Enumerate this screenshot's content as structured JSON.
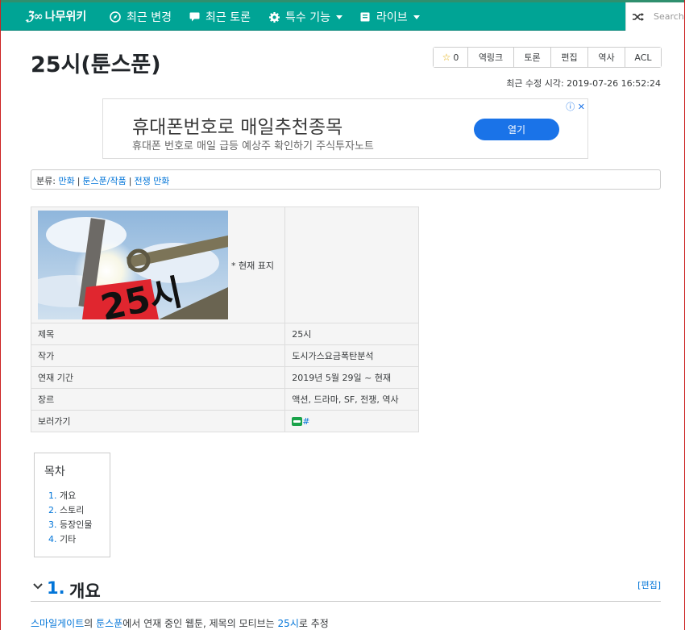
{
  "nav": {
    "brand": "나무위키",
    "items": [
      {
        "label": "최근 변경"
      },
      {
        "label": "최근 토론"
      },
      {
        "label": "특수 기능"
      },
      {
        "label": "라이브"
      }
    ],
    "search_placeholder": "Search"
  },
  "page": {
    "title": "25시(툰스푼)",
    "star_count": "0",
    "tools": [
      "역링크",
      "토론",
      "편집",
      "역사",
      "ACL"
    ],
    "last_modified": "최근 수정 시각: 2019-07-26 16:52:24"
  },
  "ad": {
    "headline": "휴대폰번호로 매일추천종목",
    "subline": "휴대폰 번호로 매일 급등 예상주 확인하기 주식투자노트",
    "button": "열기"
  },
  "category": {
    "label": "분류:",
    "links": [
      "만화",
      "툰스푼/작품",
      "전쟁 만화"
    ]
  },
  "infobox": {
    "image_caption": "* 현재 표지",
    "poster_text": "25시",
    "rows": [
      {
        "key": "제목",
        "value": "25시"
      },
      {
        "key": "작가",
        "value": "도시가스요금폭탄분석"
      },
      {
        "key": "연재 기간",
        "value": "2019년 5월 29일 ~ 현재"
      },
      {
        "key": "장르",
        "value": "액션, 드라마, SF, 전쟁, 역사"
      },
      {
        "key": "보러가기",
        "value": "#"
      }
    ]
  },
  "toc": {
    "title": "목차",
    "items": [
      {
        "num": "1.",
        "label": "개요"
      },
      {
        "num": "2.",
        "label": "스토리"
      },
      {
        "num": "3.",
        "label": "등장인물"
      },
      {
        "num": "4.",
        "label": "기타"
      }
    ]
  },
  "section": {
    "num": "1.",
    "title": "개요",
    "edit": "[편집]",
    "para": {
      "link1": "스마일게이트",
      "t1": "의 ",
      "link2": "툰스푼",
      "t2": "에서 연재 중인 웹툰, 제목의 모티브는 ",
      "link3": "25시",
      "t3": "로 추정"
    }
  },
  "colors": {
    "nav": "#00a495",
    "link": "#0275d8",
    "ad_button": "#1a73e8"
  }
}
